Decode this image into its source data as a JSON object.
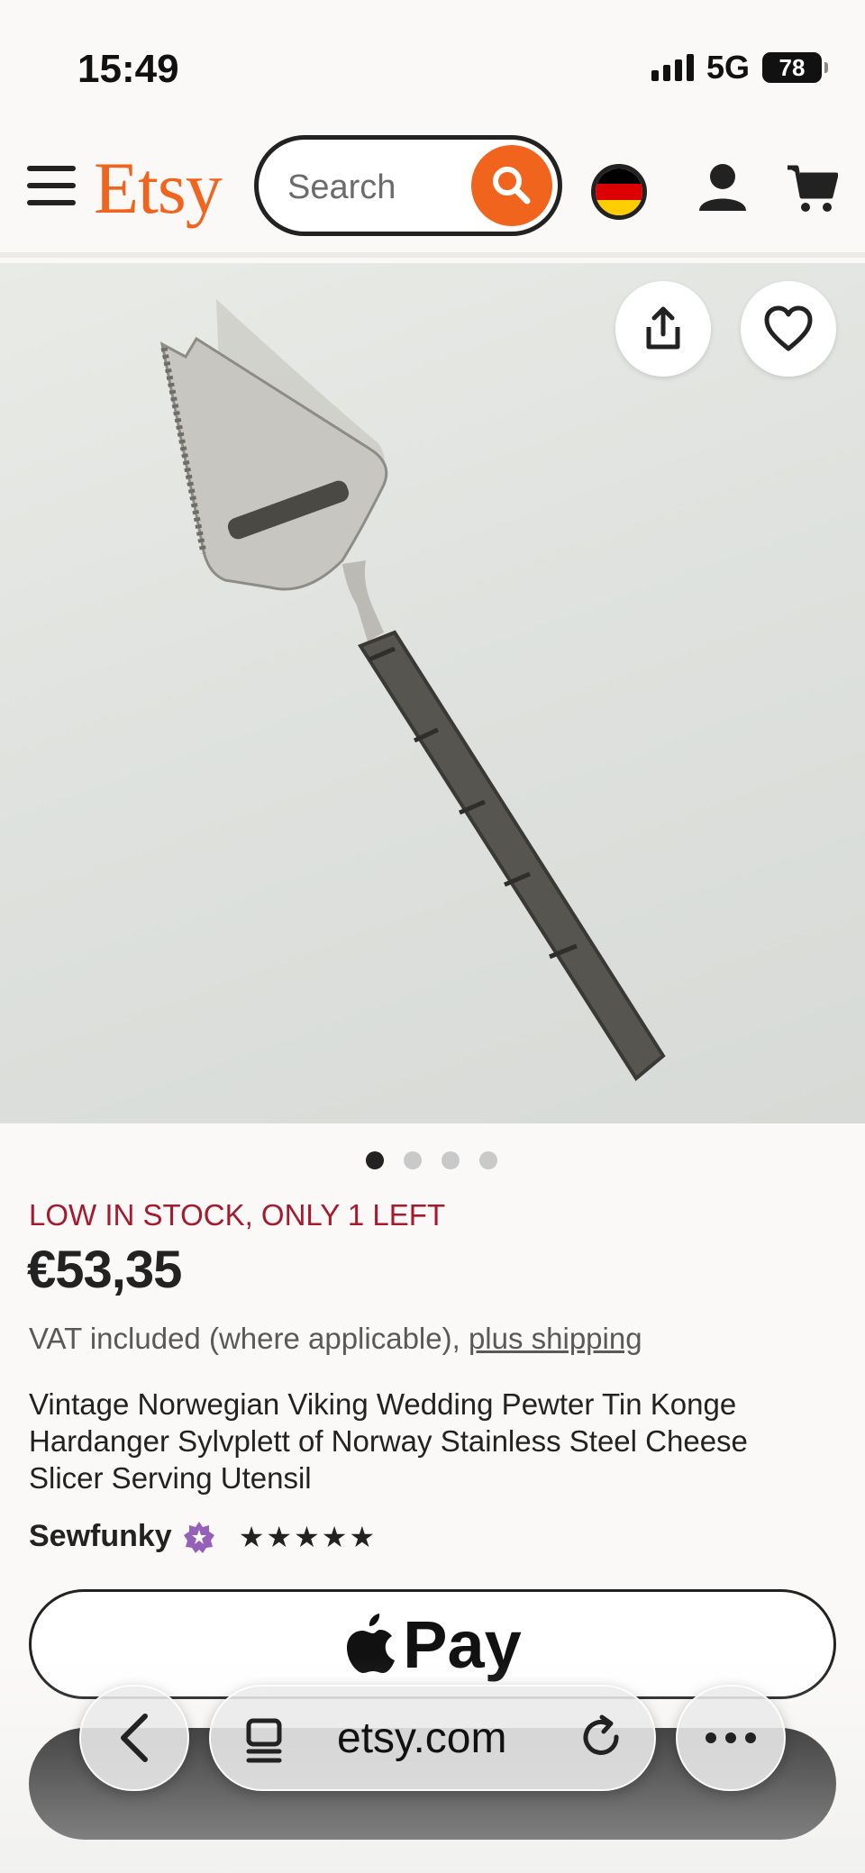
{
  "status_bar": {
    "time": "15:49",
    "network": "5G",
    "battery": "78"
  },
  "header": {
    "logo": "Etsy",
    "search_placeholder": "Search",
    "flag_colors": [
      "#000000",
      "#dd0000",
      "#ffce00"
    ]
  },
  "product": {
    "image_count": 4,
    "active_image": 1,
    "stock_notice": "LOW IN STOCK, ONLY 1 LEFT",
    "price": "€53,35",
    "vat_text": "VAT included (where applicable),",
    "shipping_link": "plus shipping",
    "title": "Vintage Norwegian Viking Wedding Pewter Tin Konge Hardanger Sylvplett of Norway Stainless Steel Cheese Slicer Serving Utensil",
    "seller": "Sewfunky",
    "rating_stars": 5
  },
  "actions": {
    "apple_pay_label": "Pay"
  },
  "browser": {
    "url": "etsy.com"
  },
  "colors": {
    "brand": "#f1641e",
    "stock_alert": "#a61a2e",
    "star_seller_badge": "#9560b8"
  }
}
